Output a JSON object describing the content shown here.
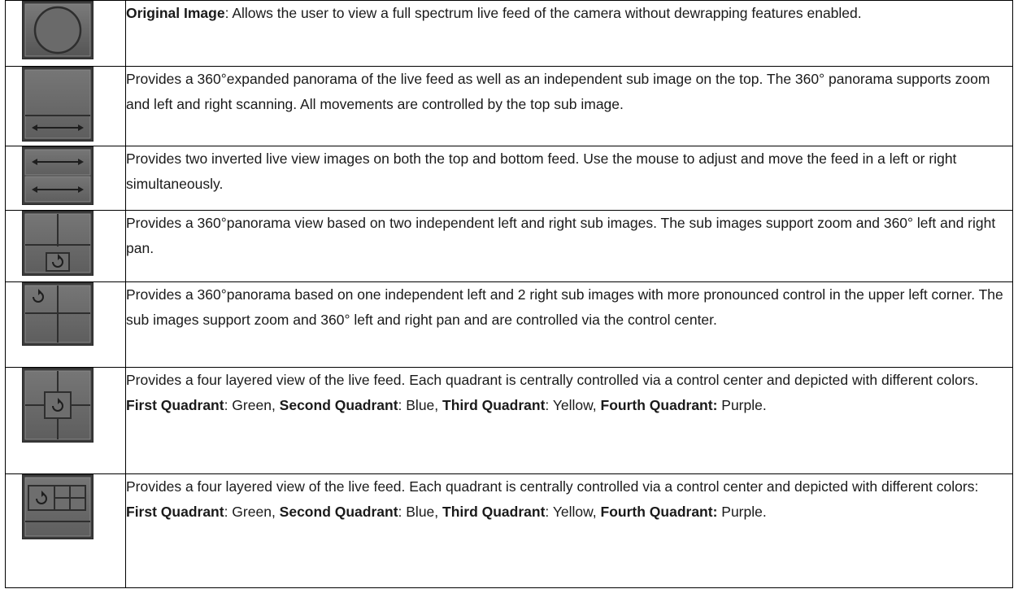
{
  "rows": [
    {
      "icon": "original-image-circle-icon",
      "segments": [
        {
          "text": "Original Image",
          "bold": true
        },
        {
          "text": ": Allows the user to view a full spectrum live feed of the camera without dewrapping features enabled.",
          "bold": false
        }
      ]
    },
    {
      "icon": "panorama-with-top-subimage-icon",
      "segments": [
        {
          "text": "Provides a 360°expanded panorama of the live feed as well as an independent sub image on the top. The 360° panorama supports zoom and left and right scanning. All movements are controlled by the top sub image.",
          "bold": false
        }
      ]
    },
    {
      "icon": "dual-inverted-panorama-icon",
      "segments": [
        {
          "text": "Provides two inverted live view images on both the top and bottom feed. Use the mouse to adjust and move the feed in a left or right simultaneously.",
          "bold": false
        }
      ]
    },
    {
      "icon": "panorama-two-subimages-icon",
      "segments": [
        {
          "text": "Provides a 360°panorama view based on two independent left and right sub images.  The sub images support zoom and 360° left and right pan.",
          "bold": false
        }
      ]
    },
    {
      "icon": "panorama-three-subimages-icon",
      "segments": [
        {
          "text": "Provides a 360°panorama based on one independent left and 2 right sub images with more pronounced control in the upper left corner. The sub images support zoom and 360° left and right pan and are controlled via the control center.",
          "bold": false
        }
      ]
    },
    {
      "icon": "quad-view-center-control-icon",
      "segments": [
        {
          "text": "Provides a four layered view of the live feed. Each quadrant is centrally controlled via a control center and depicted with different colors. ",
          "bold": false
        },
        {
          "text": "First Quadrant",
          "bold": true
        },
        {
          "text": ": Green, ",
          "bold": false
        },
        {
          "text": "Second Quadrant",
          "bold": true
        },
        {
          "text": ": Blue, ",
          "bold": false
        },
        {
          "text": "Third Quadrant",
          "bold": true
        },
        {
          "text": ": Yellow, ",
          "bold": false
        },
        {
          "text": "Fourth Quadrant:",
          "bold": true
        },
        {
          "text": " Purple.",
          "bold": false
        }
      ]
    },
    {
      "icon": "quad-view-side-control-icon",
      "segments": [
        {
          "text": "Provides a four layered view of the live feed. Each quadrant is centrally controlled via a control center and depicted with different colors: ",
          "bold": false
        },
        {
          "text": "First Quadrant",
          "bold": true
        },
        {
          "text": ": Green, ",
          "bold": false
        },
        {
          "text": "Second Quadrant",
          "bold": true
        },
        {
          "text": ": Blue, ",
          "bold": false
        },
        {
          "text": "Third Quadrant",
          "bold": true
        },
        {
          "text": ": Yellow, ",
          "bold": false
        },
        {
          "text": "Fourth Quadrant:",
          "bold": true
        },
        {
          "text": " Purple.",
          "bold": false
        }
      ]
    }
  ]
}
